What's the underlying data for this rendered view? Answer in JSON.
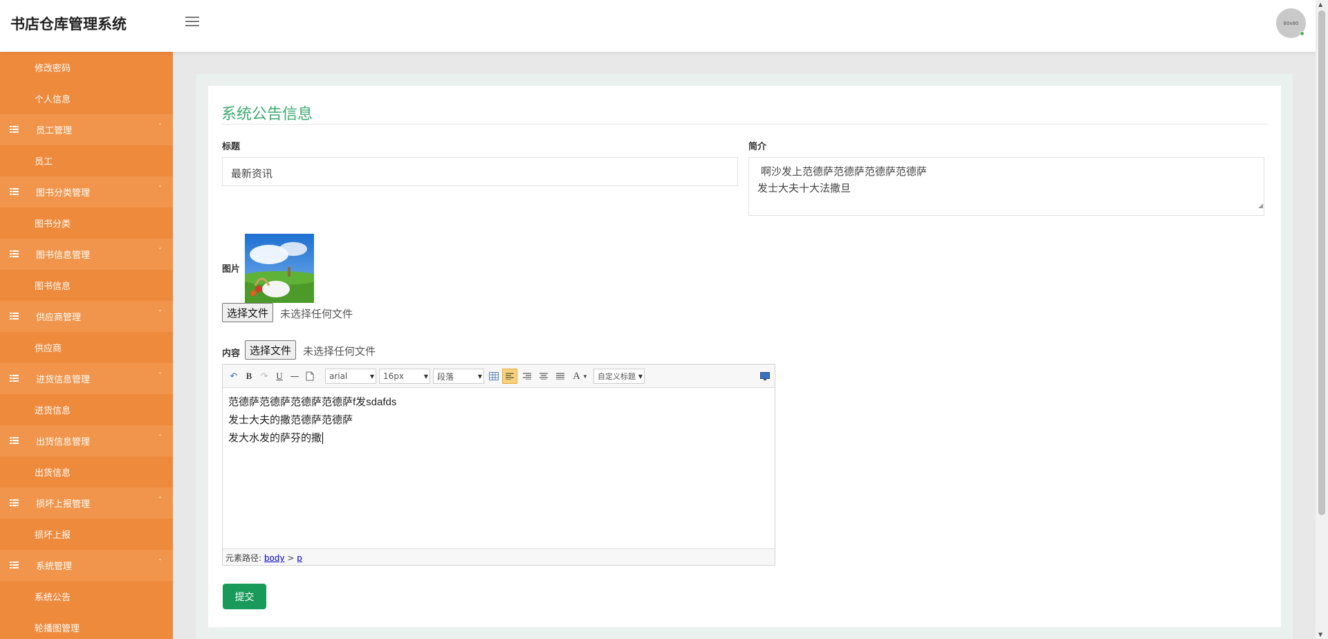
{
  "app": {
    "title": "书店仓库管理系统",
    "avatar_text": "80x80"
  },
  "sidebar": {
    "items": [
      {
        "type": "sub",
        "label": "修改密码"
      },
      {
        "type": "sub",
        "label": "个人信息"
      },
      {
        "type": "group",
        "label": "员工管理"
      },
      {
        "type": "sub",
        "label": "员工"
      },
      {
        "type": "group",
        "label": "图书分类管理"
      },
      {
        "type": "sub",
        "label": "图书分类"
      },
      {
        "type": "group",
        "label": "图书信息管理"
      },
      {
        "type": "sub",
        "label": "图书信息"
      },
      {
        "type": "group",
        "label": "供应商管理"
      },
      {
        "type": "sub",
        "label": "供应商"
      },
      {
        "type": "group",
        "label": "进货信息管理"
      },
      {
        "type": "sub",
        "label": "进货信息"
      },
      {
        "type": "group",
        "label": "出货信息管理"
      },
      {
        "type": "sub",
        "label": "出货信息"
      },
      {
        "type": "group",
        "label": "损坏上报管理"
      },
      {
        "type": "sub",
        "label": "损坏上报"
      },
      {
        "type": "group",
        "label": "系统管理"
      },
      {
        "type": "sub",
        "label": "系统公告"
      },
      {
        "type": "sub",
        "label": "轮播图管理"
      }
    ],
    "caret": "ˆ"
  },
  "form": {
    "page_title": "系统公告信息",
    "title_label": "标题",
    "title_value": "最新资讯",
    "intro_label": "简介",
    "intro_lines": [
      "啊沙发上范德萨范德萨范德萨范德萨",
      "发士大夫十大法撒旦"
    ],
    "image_label": "图片",
    "file_button": "选择文件",
    "file_status": "未选择任何文件",
    "content_label": "内容",
    "submit": "提交"
  },
  "editor": {
    "toolbar": {
      "font": "arial",
      "size": "16px",
      "paragraph": "段落",
      "custom_title": "自定义标题",
      "bold": "B",
      "underline": "U",
      "font_color": "A"
    },
    "lines": [
      "范德萨范德萨范德萨范德萨f发sdafds",
      "发士大夫的撒范德萨范德萨",
      " 发大水发的萨芬的撒"
    ],
    "status_prefix": "元素路径:",
    "path_body": "body",
    "path_sep": ">",
    "path_p": "p"
  },
  "colors": {
    "sidebar": "#ee8a3c",
    "accent": "#3aaa6e",
    "submit": "#199a5b"
  }
}
